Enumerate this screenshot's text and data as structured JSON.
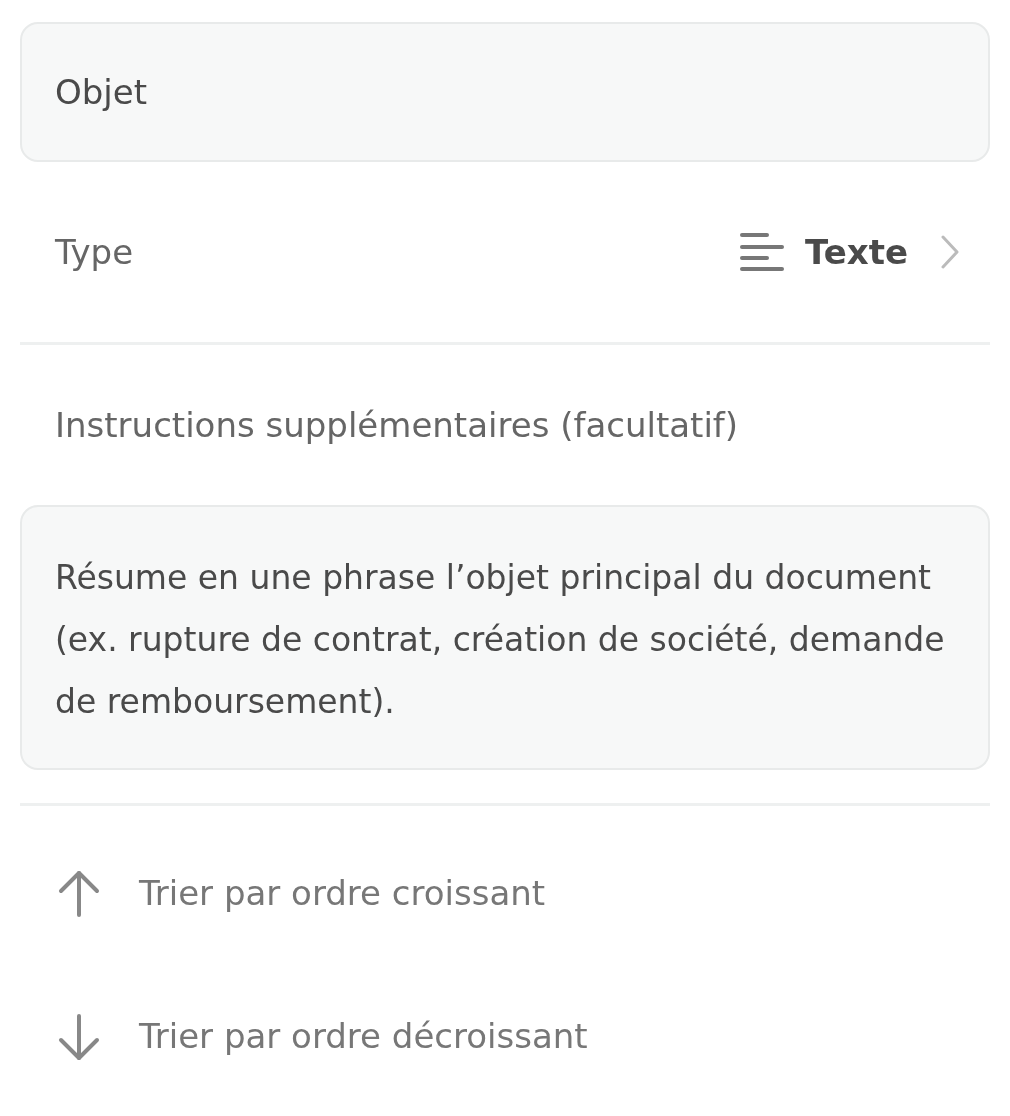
{
  "name_field": {
    "value": "Objet"
  },
  "type_row": {
    "label": "Type",
    "kind": "text",
    "value": "Texte"
  },
  "instructions": {
    "label": "Instructions supplémentaires (facultatif)",
    "value": "Résume en une phrase l’objet principal du document (ex. rupture de contrat, création de société, demande de remboursement)."
  },
  "sort_options": [
    {
      "kind": "ascending",
      "label": "Trier par ordre croissant"
    },
    {
      "kind": "descending",
      "label": "Trier par ordre décroissant"
    }
  ]
}
